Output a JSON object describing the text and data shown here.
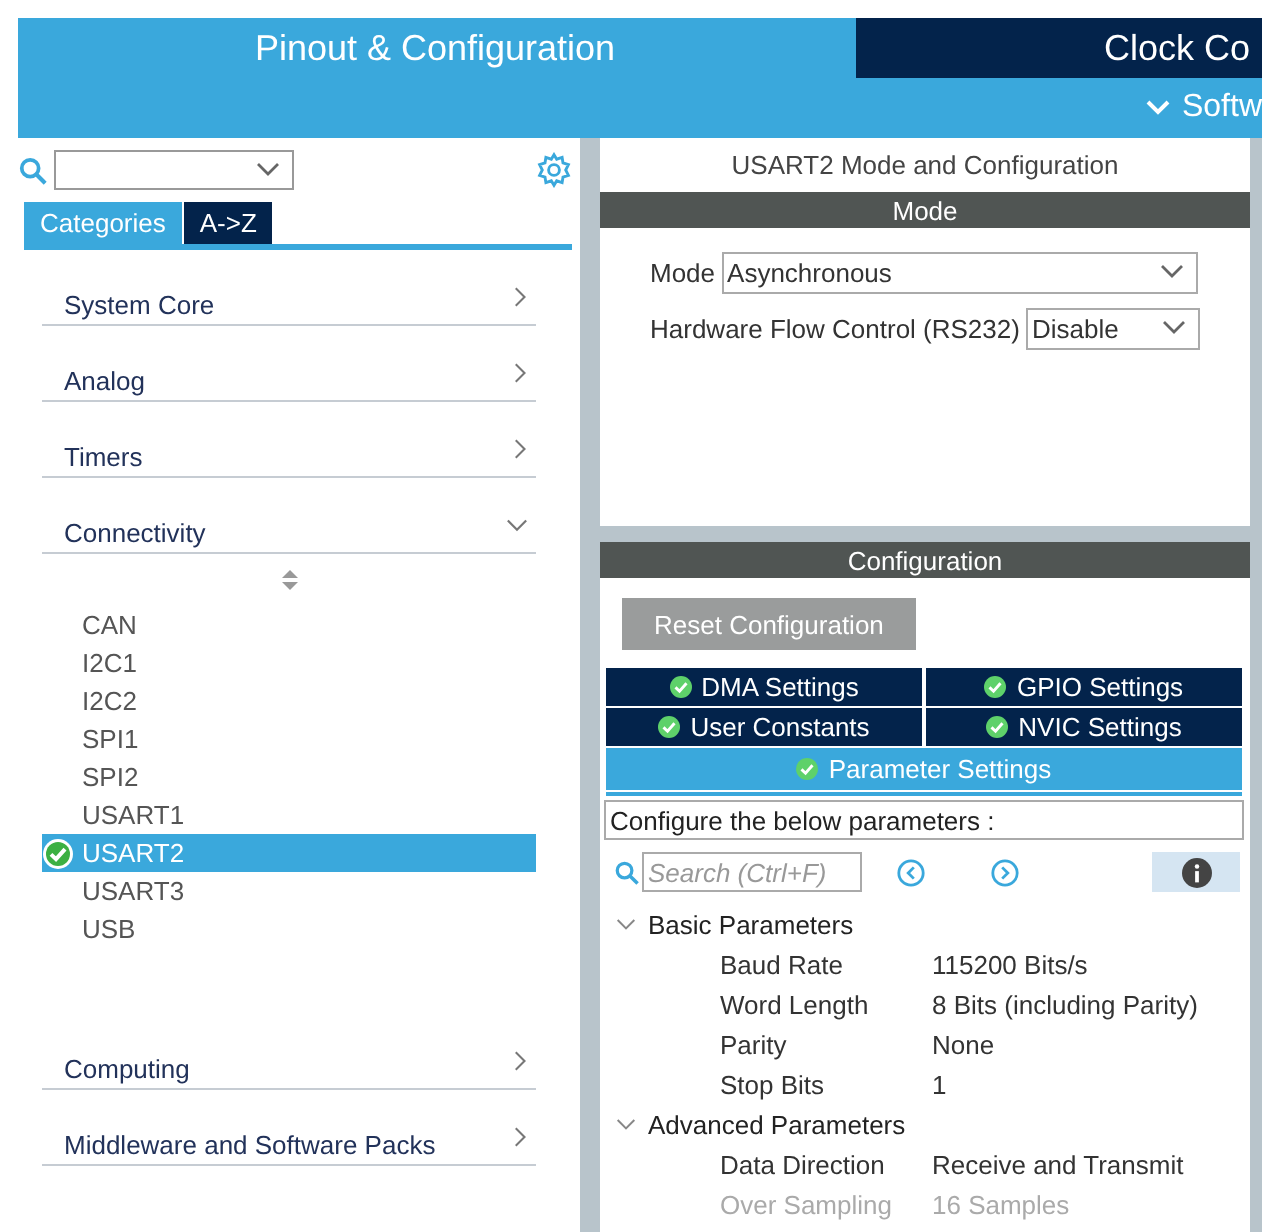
{
  "top_tabs": [
    {
      "label": "Pinout & Configuration",
      "selected": true
    },
    {
      "label": "Clock Co",
      "selected": false
    }
  ],
  "sub_header": {
    "label": "Softw"
  },
  "left": {
    "view_tabs": [
      {
        "label": "Categories",
        "selected": true
      },
      {
        "label": "A->Z",
        "selected": false
      }
    ],
    "categories": [
      {
        "label": "System Core",
        "expanded": false
      },
      {
        "label": "Analog",
        "expanded": false
      },
      {
        "label": "Timers",
        "expanded": false
      },
      {
        "label": "Connectivity",
        "expanded": true,
        "children": [
          {
            "label": "CAN",
            "selected": false,
            "configured": false
          },
          {
            "label": "I2C1",
            "selected": false,
            "configured": false
          },
          {
            "label": "I2C2",
            "selected": false,
            "configured": false
          },
          {
            "label": "SPI1",
            "selected": false,
            "configured": false
          },
          {
            "label": "SPI2",
            "selected": false,
            "configured": false
          },
          {
            "label": "USART1",
            "selected": false,
            "configured": false
          },
          {
            "label": "USART2",
            "selected": true,
            "configured": true
          },
          {
            "label": "USART3",
            "selected": false,
            "configured": false
          },
          {
            "label": "USB",
            "selected": false,
            "configured": false
          }
        ]
      },
      {
        "label": "Computing",
        "expanded": false
      },
      {
        "label": "Middleware and Software Packs",
        "expanded": false
      }
    ]
  },
  "right": {
    "title": "USART2 Mode and Configuration",
    "mode_header": "Mode",
    "mode_fields": [
      {
        "label": "Mode",
        "value": "Asynchronous",
        "wide": true
      },
      {
        "label": "Hardware Flow Control (RS232)",
        "value": "Disable",
        "wide": false
      }
    ],
    "config_header": "Configuration",
    "reset_button": "Reset Configuration",
    "tab_rows": [
      {
        "tabs": [
          {
            "label": "DMA Settings",
            "selected": false
          },
          {
            "label": "GPIO Settings",
            "selected": false
          }
        ]
      },
      {
        "tabs": [
          {
            "label": "User Constants",
            "selected": false
          },
          {
            "label": "NVIC Settings",
            "selected": false
          }
        ]
      },
      {
        "tabs": [
          {
            "label": "Parameter Settings",
            "selected": true
          }
        ]
      }
    ],
    "description": "Configure the below parameters :",
    "param_search": {
      "placeholder": "Search (Ctrl+F)"
    },
    "groups": [
      {
        "label": "Basic Parameters",
        "expanded": true,
        "params": [
          {
            "name": "Baud Rate",
            "value": "115200 Bits/s",
            "disabled": false
          },
          {
            "name": "Word Length",
            "value": "8 Bits (including Parity)",
            "disabled": false
          },
          {
            "name": "Parity",
            "value": "None",
            "disabled": false
          },
          {
            "name": "Stop Bits",
            "value": "1",
            "disabled": false
          }
        ]
      },
      {
        "label": "Advanced Parameters",
        "expanded": true,
        "params": [
          {
            "name": "Data Direction",
            "value": "Receive and Transmit",
            "disabled": false
          },
          {
            "name": "Over Sampling",
            "value": "16 Samples",
            "disabled": true
          }
        ]
      }
    ]
  }
}
